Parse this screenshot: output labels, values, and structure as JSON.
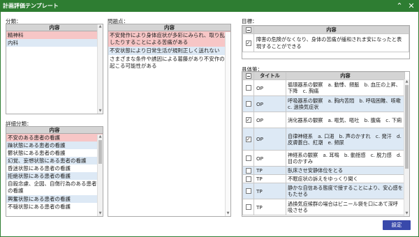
{
  "window": {
    "title": "計画評価テンプレート"
  },
  "bunrui": {
    "label": "分類：",
    "header": "内容",
    "items": [
      "精神科",
      "内科"
    ]
  },
  "shousai": {
    "label": "詳細分類：",
    "header": "内容",
    "items": [
      "不安のある患者の看護",
      "躁状態にある患者の看護",
      "鬱状態にある患者の看護",
      "幻覚、妄想状態にある患者の看護",
      "昏迷状態にある患者の看護",
      "拒絶状態にある患者の看護",
      "自殺念慮、企図、自傷行為のある患者の看護",
      "興奮状態にある患者の看護",
      "不穏状態にある患者の看護"
    ]
  },
  "mondai": {
    "label": "問題点：",
    "header": "内容",
    "items": [
      "不安発作により身体症状が多彩にみられ、取り乱したりすることによる苦痛がある",
      "不安状態により日常生活が規則正しく送れない",
      "さまざまな条件や誘因による葛藤があり不安作の起こる可能性がある"
    ]
  },
  "mokuhyo": {
    "label": "目標：",
    "header": "内容",
    "items": [
      "障害の危険がなくなり、身体の苦痛が緩和されま安になったと表現することができる"
    ]
  },
  "gutaisaku": {
    "label": "具体策：",
    "col_title": "タイトル",
    "col_content": "内容",
    "rows": [
      {
        "title": "OP",
        "content": "循環器系の観察　a. 動悸、頻脈　b. 血圧の上昇、下降　c. 胸痛",
        "checked": false
      },
      {
        "title": "OP",
        "content": "呼吸器系の観察　a. 胸内苦悶　b. 呼吸困難、咳嗽　c. 過換気症状",
        "checked": false
      },
      {
        "title": "OP",
        "content": "消化器系の観察　a. 嘔気、嘔吐　b. 腹痛　c. 下痢",
        "checked": true
      },
      {
        "title": "OP",
        "content": "自律神経系　a. 口渇　b. 声のかすれ　c. 発汗　d. 皮膚蒼白、紅潮　e. 頻尿",
        "checked": true
      },
      {
        "title": "OP",
        "content": "神経系の観察　a. 耳鳴　b. 動揺感　c. 脱力感　d. 目のかすみ",
        "checked": false
      },
      {
        "title": "TP",
        "content": "臥床させ安静体位をとる",
        "checked": false
      },
      {
        "title": "TP",
        "content": "不眠症状の訴えをゆっくり聞く",
        "checked": false
      },
      {
        "title": "TP",
        "content": "静かな自信ある態度で接することにより、安心感をもたせる",
        "checked": false
      },
      {
        "title": "TP",
        "content": "過換気症候群の場合はビニール袋を口にあて深呼吸させる",
        "checked": false
      }
    ]
  },
  "settei_label": "設定"
}
